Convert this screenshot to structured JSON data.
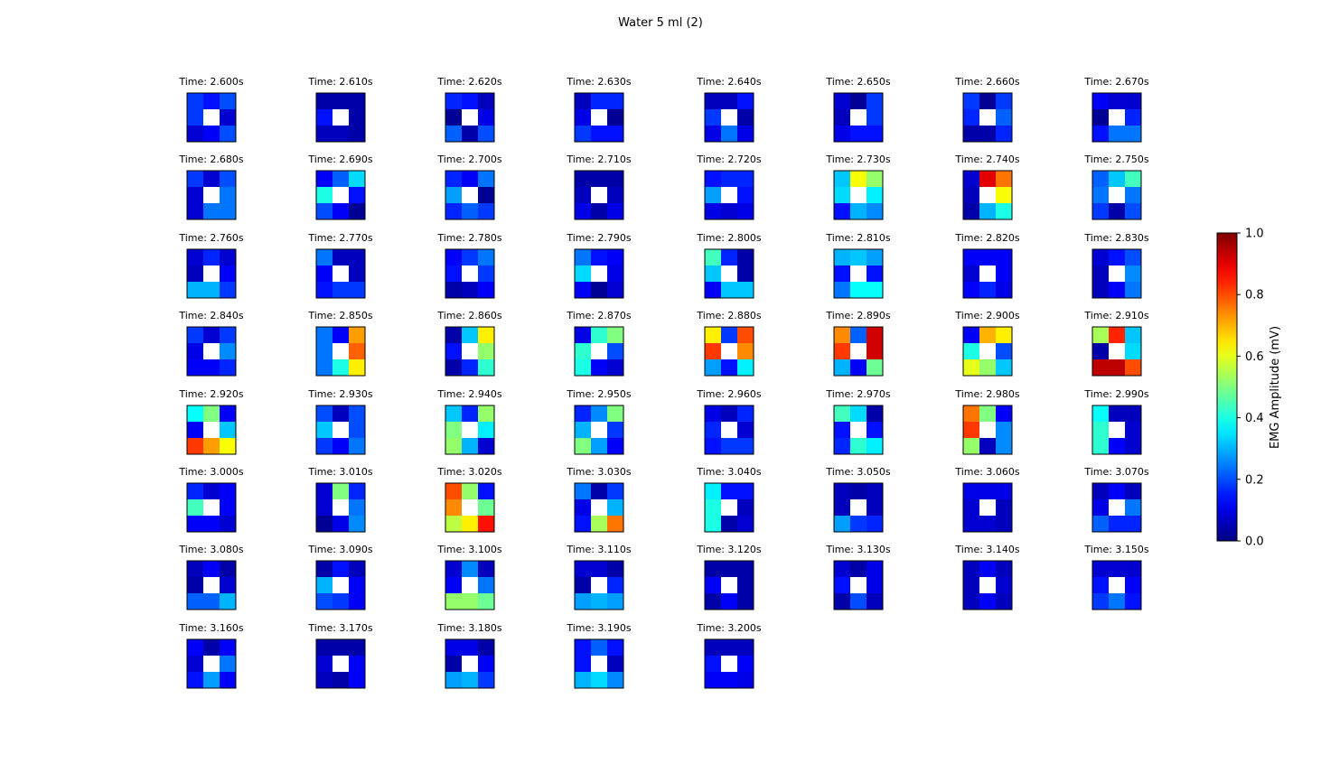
{
  "chart_data": {
    "type": "heatmap",
    "title": "Water 5 ml (2)",
    "panel_title_prefix": "Time: ",
    "panel_title_suffix": "s",
    "grid": false,
    "layout": {
      "rows": 8,
      "cols": 8
    },
    "colormap": "jet",
    "nan_color": "#ffffff",
    "colorbar": {
      "label": "EMG Amplitude (mV)",
      "vmin": 0.0,
      "vmax": 1.0,
      "ticks": [
        0.0,
        0.2,
        0.4,
        0.6,
        0.8,
        1.0
      ],
      "tick_labels": [
        "0.0",
        "0.2",
        "0.4",
        "0.6",
        "0.8",
        "1.0"
      ]
    },
    "panels": [
      {
        "time": "2.600",
        "values": [
          [
            0.18,
            0.14,
            0.2
          ],
          [
            0.18,
            null,
            0.08
          ],
          [
            0.08,
            0.12,
            0.2
          ]
        ]
      },
      {
        "time": "2.610",
        "values": [
          [
            0.04,
            0.04,
            0.04
          ],
          [
            0.14,
            null,
            0.04
          ],
          [
            0.06,
            0.06,
            0.04
          ]
        ]
      },
      {
        "time": "2.620",
        "values": [
          [
            0.16,
            0.14,
            0.06
          ],
          [
            0.02,
            null,
            0.1
          ],
          [
            0.22,
            0.04,
            0.2
          ]
        ]
      },
      {
        "time": "2.630",
        "values": [
          [
            0.06,
            0.16,
            0.16
          ],
          [
            0.1,
            null,
            0.02
          ],
          [
            0.18,
            0.14,
            0.14
          ]
        ]
      },
      {
        "time": "2.640",
        "values": [
          [
            0.06,
            0.06,
            0.14
          ],
          [
            0.18,
            null,
            0.04
          ],
          [
            0.1,
            0.24,
            0.1
          ]
        ]
      },
      {
        "time": "2.650",
        "values": [
          [
            0.08,
            0.02,
            0.18
          ],
          [
            0.06,
            null,
            0.18
          ],
          [
            0.1,
            0.14,
            0.14
          ]
        ]
      },
      {
        "time": "2.660",
        "values": [
          [
            0.18,
            0.02,
            0.18
          ],
          [
            0.16,
            null,
            0.22
          ],
          [
            0.04,
            0.04,
            0.16
          ]
        ]
      },
      {
        "time": "2.670",
        "values": [
          [
            0.12,
            0.08,
            0.08
          ],
          [
            0.02,
            null,
            0.16
          ],
          [
            0.14,
            0.24,
            0.24
          ]
        ]
      },
      {
        "time": "2.680",
        "values": [
          [
            0.18,
            0.08,
            0.2
          ],
          [
            0.08,
            null,
            0.24
          ],
          [
            0.08,
            0.24,
            0.24
          ]
        ]
      },
      {
        "time": "2.690",
        "values": [
          [
            0.12,
            0.22,
            0.34
          ],
          [
            0.4,
            null,
            0.14
          ],
          [
            0.2,
            0.12,
            0.02
          ]
        ]
      },
      {
        "time": "2.700",
        "values": [
          [
            0.16,
            0.12,
            0.24
          ],
          [
            0.28,
            null,
            0.02
          ],
          [
            0.16,
            0.22,
            0.18
          ]
        ]
      },
      {
        "time": "2.710",
        "values": [
          [
            0.04,
            0.04,
            0.04
          ],
          [
            0.06,
            null,
            0.06
          ],
          [
            0.1,
            0.04,
            0.1
          ]
        ]
      },
      {
        "time": "2.720",
        "values": [
          [
            0.14,
            0.16,
            0.16
          ],
          [
            0.28,
            null,
            0.14
          ],
          [
            0.1,
            0.08,
            0.1
          ]
        ]
      },
      {
        "time": "2.730",
        "values": [
          [
            0.32,
            0.62,
            0.52
          ],
          [
            0.34,
            null,
            0.36
          ],
          [
            0.14,
            0.3,
            0.26
          ]
        ]
      },
      {
        "time": "2.740",
        "values": [
          [
            0.08,
            0.9,
            0.76
          ],
          [
            0.06,
            null,
            0.62
          ],
          [
            0.04,
            0.3,
            0.4
          ]
        ]
      },
      {
        "time": "2.750",
        "values": [
          [
            0.22,
            0.32,
            0.44
          ],
          [
            0.24,
            null,
            0.24
          ],
          [
            0.18,
            0.04,
            0.2
          ]
        ]
      },
      {
        "time": "2.760",
        "values": [
          [
            0.08,
            0.16,
            0.08
          ],
          [
            0.06,
            null,
            0.12
          ],
          [
            0.3,
            0.3,
            0.18
          ]
        ]
      },
      {
        "time": "2.770",
        "values": [
          [
            0.24,
            0.06,
            0.06
          ],
          [
            0.12,
            null,
            0.06
          ],
          [
            0.14,
            0.18,
            0.18
          ]
        ]
      },
      {
        "time": "2.780",
        "values": [
          [
            0.12,
            0.18,
            0.24
          ],
          [
            0.14,
            null,
            0.18
          ],
          [
            0.04,
            0.06,
            0.12
          ]
        ]
      },
      {
        "time": "2.790",
        "values": [
          [
            0.24,
            0.14,
            0.12
          ],
          [
            0.34,
            null,
            0.1
          ],
          [
            0.12,
            0.02,
            0.08
          ]
        ]
      },
      {
        "time": "2.800",
        "values": [
          [
            0.44,
            0.16,
            0.04
          ],
          [
            0.32,
            null,
            0.04
          ],
          [
            0.12,
            0.32,
            0.32
          ]
        ]
      },
      {
        "time": "2.810",
        "values": [
          [
            0.3,
            0.32,
            0.28
          ],
          [
            0.14,
            null,
            0.14
          ],
          [
            0.24,
            0.38,
            0.38
          ]
        ]
      },
      {
        "time": "2.820",
        "values": [
          [
            0.12,
            0.12,
            0.12
          ],
          [
            0.08,
            null,
            0.12
          ],
          [
            0.12,
            0.16,
            0.1
          ]
        ]
      },
      {
        "time": "2.830",
        "values": [
          [
            0.08,
            0.14,
            0.2
          ],
          [
            0.06,
            null,
            0.26
          ],
          [
            0.06,
            0.12,
            0.24
          ]
        ]
      },
      {
        "time": "2.840",
        "values": [
          [
            0.18,
            0.08,
            0.18
          ],
          [
            0.1,
            null,
            0.26
          ],
          [
            0.12,
            0.12,
            0.16
          ]
        ]
      },
      {
        "time": "2.850",
        "values": [
          [
            0.24,
            0.12,
            0.72
          ],
          [
            0.24,
            null,
            0.78
          ],
          [
            0.24,
            0.4,
            0.64
          ]
        ]
      },
      {
        "time": "2.860",
        "values": [
          [
            0.04,
            0.32,
            0.64
          ],
          [
            0.14,
            null,
            0.52
          ],
          [
            0.04,
            0.16,
            0.42
          ]
        ]
      },
      {
        "time": "2.870",
        "values": [
          [
            0.1,
            0.42,
            0.5
          ],
          [
            0.42,
            null,
            0.2
          ],
          [
            0.4,
            0.12,
            0.08
          ]
        ]
      },
      {
        "time": "2.880",
        "values": [
          [
            0.64,
            0.18,
            0.8
          ],
          [
            0.82,
            null,
            0.74
          ],
          [
            0.28,
            0.14,
            0.36
          ]
        ]
      },
      {
        "time": "2.890",
        "values": [
          [
            0.74,
            0.22,
            0.92
          ],
          [
            0.82,
            null,
            0.92
          ],
          [
            0.3,
            0.12,
            0.48
          ]
        ]
      },
      {
        "time": "2.900",
        "values": [
          [
            0.12,
            0.7,
            0.64
          ],
          [
            0.4,
            null,
            0.2
          ],
          [
            0.6,
            0.52,
            0.32
          ]
        ]
      },
      {
        "time": "2.910",
        "values": [
          [
            0.54,
            0.84,
            0.32
          ],
          [
            0.04,
            null,
            0.34
          ],
          [
            0.94,
            0.94,
            0.8
          ]
        ]
      },
      {
        "time": "2.920",
        "values": [
          [
            0.38,
            0.5,
            0.12
          ],
          [
            0.12,
            null,
            0.32
          ],
          [
            0.82,
            0.72,
            0.62
          ]
        ]
      },
      {
        "time": "2.930",
        "values": [
          [
            0.2,
            0.06,
            0.2
          ],
          [
            0.32,
            null,
            0.2
          ],
          [
            0.18,
            0.12,
            0.24
          ]
        ]
      },
      {
        "time": "2.940",
        "values": [
          [
            0.32,
            0.16,
            0.52
          ],
          [
            0.5,
            null,
            0.36
          ],
          [
            0.52,
            0.3,
            0.08
          ]
        ]
      },
      {
        "time": "2.950",
        "values": [
          [
            0.16,
            0.26,
            0.5
          ],
          [
            0.3,
            null,
            0.18
          ],
          [
            0.5,
            0.28,
            0.12
          ]
        ]
      },
      {
        "time": "2.960",
        "values": [
          [
            0.1,
            0.06,
            0.16
          ],
          [
            0.16,
            null,
            0.08
          ],
          [
            0.14,
            0.18,
            0.18
          ]
        ]
      },
      {
        "time": "2.970",
        "values": [
          [
            0.44,
            0.34,
            0.04
          ],
          [
            0.14,
            null,
            0.14
          ],
          [
            0.16,
            0.42,
            0.36
          ]
        ]
      },
      {
        "time": "2.980",
        "values": [
          [
            0.76,
            0.5,
            0.12
          ],
          [
            0.82,
            null,
            0.26
          ],
          [
            0.52,
            0.06,
            0.26
          ]
        ]
      },
      {
        "time": "2.990",
        "values": [
          [
            0.38,
            0.06,
            0.06
          ],
          [
            0.42,
            null,
            0.08
          ],
          [
            0.42,
            0.12,
            0.08
          ]
        ]
      },
      {
        "time": "3.000",
        "values": [
          [
            0.16,
            0.08,
            0.12
          ],
          [
            0.44,
            null,
            0.12
          ],
          [
            0.12,
            0.12,
            0.08
          ]
        ]
      },
      {
        "time": "3.010",
        "values": [
          [
            0.08,
            0.5,
            0.16
          ],
          [
            0.08,
            null,
            0.24
          ],
          [
            0.02,
            0.1,
            0.26
          ]
        ]
      },
      {
        "time": "3.020",
        "values": [
          [
            0.8,
            0.52,
            0.14
          ],
          [
            0.74,
            null,
            0.48
          ],
          [
            0.56,
            0.64,
            0.86
          ]
        ]
      },
      {
        "time": "3.030",
        "values": [
          [
            0.24,
            0.04,
            0.18
          ],
          [
            0.1,
            null,
            0.3
          ],
          [
            0.14,
            0.54,
            0.76
          ]
        ]
      },
      {
        "time": "3.040",
        "values": [
          [
            0.36,
            0.14,
            0.14
          ],
          [
            0.4,
            null,
            0.06
          ],
          [
            0.4,
            0.04,
            0.08
          ]
        ]
      },
      {
        "time": "3.050",
        "values": [
          [
            0.06,
            0.04,
            0.06
          ],
          [
            0.06,
            null,
            0.06
          ],
          [
            0.28,
            0.18,
            0.16
          ]
        ]
      },
      {
        "time": "3.060",
        "values": [
          [
            0.1,
            0.1,
            0.1
          ],
          [
            0.08,
            null,
            0.06
          ],
          [
            0.08,
            0.08,
            0.06
          ]
        ]
      },
      {
        "time": "3.070",
        "values": [
          [
            0.06,
            0.12,
            0.06
          ],
          [
            0.1,
            null,
            0.24
          ],
          [
            0.22,
            0.16,
            0.16
          ]
        ]
      },
      {
        "time": "3.080",
        "values": [
          [
            0.06,
            0.12,
            0.04
          ],
          [
            0.04,
            null,
            0.08
          ],
          [
            0.22,
            0.22,
            0.3
          ]
        ]
      },
      {
        "time": "3.090",
        "values": [
          [
            0.04,
            0.14,
            0.06
          ],
          [
            0.3,
            null,
            0.12
          ],
          [
            0.2,
            0.18,
            0.12
          ]
        ]
      },
      {
        "time": "3.100",
        "values": [
          [
            0.08,
            0.26,
            0.06
          ],
          [
            0.12,
            null,
            0.24
          ],
          [
            0.52,
            0.52,
            0.48
          ]
        ]
      },
      {
        "time": "3.110",
        "values": [
          [
            0.08,
            0.08,
            0.04
          ],
          [
            0.04,
            null,
            0.16
          ],
          [
            0.28,
            0.3,
            0.28
          ]
        ]
      },
      {
        "time": "3.120",
        "values": [
          [
            0.04,
            0.04,
            0.04
          ],
          [
            0.12,
            null,
            0.04
          ],
          [
            0.04,
            0.12,
            0.04
          ]
        ]
      },
      {
        "time": "3.130",
        "values": [
          [
            0.08,
            0.04,
            0.1
          ],
          [
            0.14,
            null,
            0.1
          ],
          [
            0.04,
            0.2,
            0.06
          ]
        ]
      },
      {
        "time": "3.140",
        "values": [
          [
            0.06,
            0.12,
            0.06
          ],
          [
            0.06,
            null,
            0.08
          ],
          [
            0.06,
            0.12,
            0.06
          ]
        ]
      },
      {
        "time": "3.150",
        "values": [
          [
            0.08,
            0.08,
            0.08
          ],
          [
            0.14,
            null,
            0.12
          ],
          [
            0.18,
            0.24,
            0.14
          ]
        ]
      },
      {
        "time": "3.160",
        "values": [
          [
            0.12,
            0.04,
            0.12
          ],
          [
            0.08,
            null,
            0.24
          ],
          [
            0.14,
            0.28,
            0.12
          ]
        ]
      },
      {
        "time": "3.170",
        "values": [
          [
            0.04,
            0.04,
            0.04
          ],
          [
            0.08,
            null,
            0.12
          ],
          [
            0.06,
            0.04,
            0.12
          ]
        ]
      },
      {
        "time": "3.180",
        "values": [
          [
            0.1,
            0.1,
            0.04
          ],
          [
            0.04,
            null,
            0.12
          ],
          [
            0.28,
            0.3,
            0.18
          ]
        ]
      },
      {
        "time": "3.190",
        "values": [
          [
            0.14,
            0.22,
            0.14
          ],
          [
            0.14,
            null,
            0.06
          ],
          [
            0.3,
            0.34,
            0.26
          ]
        ]
      },
      {
        "time": "3.200",
        "values": [
          [
            0.06,
            0.06,
            0.06
          ],
          [
            0.14,
            null,
            0.12
          ],
          [
            0.12,
            0.12,
            0.1
          ]
        ]
      }
    ]
  }
}
